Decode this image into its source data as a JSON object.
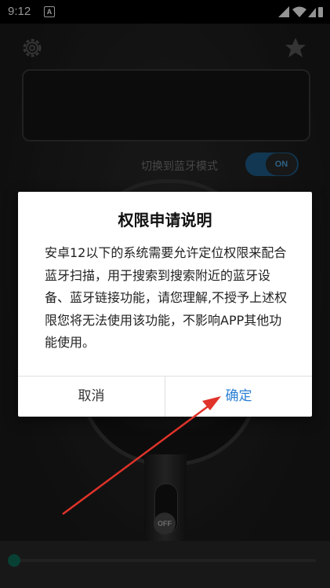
{
  "status_bar": {
    "time": "9:12",
    "notification_letter": "A"
  },
  "app": {
    "switch_label": "切换到蓝牙模式",
    "toggle_text": "ON",
    "mic_button_text": "OFF",
    "progress": 0.0
  },
  "dialog": {
    "title": "权限申请说明",
    "body": "安卓12以下的系统需要允许定位权限来配合蓝牙扫描，用于搜索到搜索附近的蓝牙设备、蓝牙链接功能，请您理解,不授予上述权限您将无法使用该功能，不影响APP其他功能使用。",
    "cancel_label": "取消",
    "confirm_label": "确定"
  },
  "colors": {
    "accent": "#2a7fd4",
    "annotation_arrow": "#e0332a",
    "toggle_on": "#1e5f8e"
  }
}
